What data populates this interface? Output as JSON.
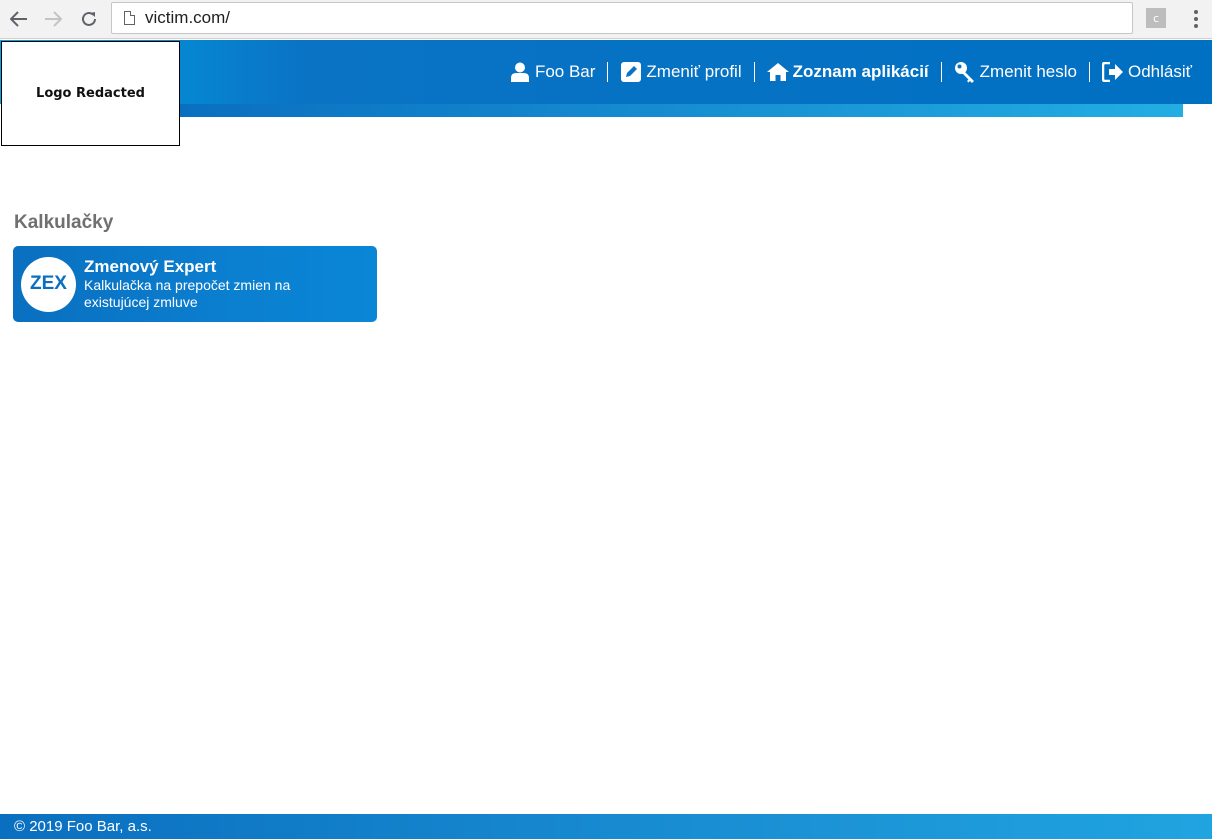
{
  "browser": {
    "url": "victim.com/",
    "extension_letter": "c"
  },
  "logo": {
    "text": "Logo Redacted"
  },
  "topnav": {
    "user": "Foo Bar",
    "edit_profile": "Zmeniť profil",
    "app_list": "Zoznam aplikácií",
    "change_password": "Zmenit heslo",
    "logout": "Odhlásiť"
  },
  "main": {
    "section_title": "Kalkulačky",
    "apps": [
      {
        "badge": "ZEX",
        "name": "Zmenový Expert",
        "description": "Kalkulačka na prepočet zmien na existujúcej zmluve"
      }
    ]
  },
  "footer": {
    "copyright": "© 2019 Foo Bar, a.s."
  },
  "colors": {
    "brand_blue": "#0070c3",
    "light_blue": "#22aee3",
    "title_gray": "#707070"
  }
}
